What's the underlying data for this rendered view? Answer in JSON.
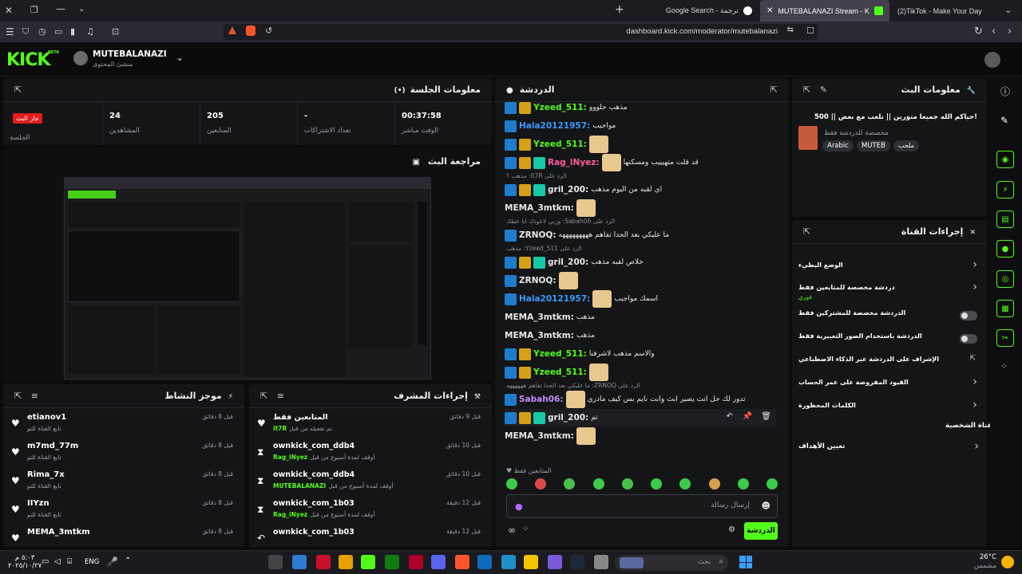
{
  "browser": {
    "tabs": [
      {
        "label": "Google Search - ترجمة"
      },
      {
        "label": "MUTEBALANAZI Stream - Kick D"
      },
      {
        "label": "(2)TikTok - Make Your Day"
      }
    ],
    "url": "dashboard.kick.com/moderator/mutebalanazi"
  },
  "header": {
    "logo": "KICK",
    "beta": "BETA",
    "channel_name": "MUTEBALANAZI",
    "channel_sub": "منشئ المحتوى"
  },
  "session": {
    "title": "معلومات الجلسة",
    "live_badge": "جار البث",
    "session_label": "الجلسة",
    "stats": [
      {
        "value": "24",
        "label": "المشاهدين"
      },
      {
        "value": "205",
        "label": "المتابعين"
      },
      {
        "value": "-",
        "label": "تعداد الاشتراكات"
      },
      {
        "value": "00:37:58",
        "label": "الوقت مباشر"
      }
    ]
  },
  "preview": {
    "title": "مراجعة البث"
  },
  "activity": {
    "title": "موجز النشاط",
    "items": [
      {
        "name": "etianov1",
        "sub": "تابع القناة للتو",
        "time": "قبل 8 دقائق"
      },
      {
        "name": "m7md_77m",
        "sub": "تابع القناة للتو",
        "time": "قبل 8 دقائق"
      },
      {
        "name": "Rima_7x",
        "sub": "تابع القناة للتو",
        "time": "قبل 8 دقائق"
      },
      {
        "name": "IIYzn",
        "sub": "تابع القناة للتو",
        "time": "قبل 8 دقائق"
      },
      {
        "name": "MEMA_3mtkm",
        "sub": "",
        "time": "قبل 8 دقائق"
      }
    ]
  },
  "mod": {
    "title": "إجراءات المشرف",
    "items": [
      {
        "name": "المتابعين فقط",
        "sub": "تم تفعيله من قبل",
        "actor": "it7R",
        "time": "قبل 9 دقائق"
      },
      {
        "name": "ownkick_com_ddb4",
        "sub": "أوقف لمدة أسبوع من قبل",
        "actor": "Rag_iNyez",
        "time": "قبل 10 دقائق"
      },
      {
        "name": "ownkick_com_ddb4",
        "sub": "أوقف لمدة أسبوع من قبل",
        "actor": "MUTEBALANAZI",
        "time": "قبل 10 دقائق"
      },
      {
        "name": "ownkick_com_1b03",
        "sub": "أوقف لمدة أسبوع من قبل",
        "actor": "Rag_iNyez",
        "time": "قبل 12 دقيقة"
      },
      {
        "name": "ownkick_com_1b03",
        "sub": "",
        "actor": "",
        "time": "قبل 12 دقيقة"
      }
    ]
  },
  "chat": {
    "title": "الدردشة",
    "messages": [
      {
        "user": "Yzeed_511:",
        "text": "مذهب حلووو",
        "color": "#53fc18"
      },
      {
        "user": "Hala20121957:",
        "text": "مواجيب",
        "color": "#3b9cff"
      },
      {
        "user": "Yzeed_511:",
        "text": "",
        "color": "#53fc18"
      },
      {
        "user": "Rag_iNyez:",
        "text": "قد قلت متهيييب ومسكنها",
        "color": "#ff5fa2"
      },
      {
        "user": "gril_200:",
        "text": "اي لقبه من اليوم مذهب",
        "color": "#e8e8e8",
        "reply": "الرد على it7R: مذهب ؟"
      },
      {
        "user": "MEMA_3mtkm:",
        "text": "",
        "color": "#e8e8e8"
      },
      {
        "user": "ZRNOQ:",
        "text": "ما عليكي بعد الحدا تفاهم هههههههههه",
        "color": "#e8e8e8",
        "reply": "الرد على Sabah06: وربي لاعوذك انا عطك"
      },
      {
        "user": "gril_200:",
        "text": "خلاص لقبه مذهب",
        "color": "#e8e8e8",
        "reply": "الرد على Yzeed_511: مذهب"
      },
      {
        "user": "ZRNOQ:",
        "text": "",
        "color": "#e8e8e8"
      },
      {
        "user": "Hala20121957:",
        "text": "اسمك مواجيب",
        "color": "#3b9cff"
      },
      {
        "user": "MEMA_3mtkm:",
        "text": "مذهب",
        "color": "#e8e8e8"
      },
      {
        "user": "MEMA_3mtkm:",
        "text": "مذهب",
        "color": "#e8e8e8"
      },
      {
        "user": "Yzeed_511:",
        "text": "والاسم مذهب لاشرفنا",
        "color": "#53fc18"
      },
      {
        "user": "Yzeed_511:",
        "text": "",
        "color": "#53fc18"
      },
      {
        "user": "Sabah06:",
        "text": "تدور لك حل انت يصير ابث وانت نايم بس كيف مادري",
        "color": "#c58af9",
        "reply": "الرد على ZRNOQ: ما عليكي بعد الحدا تفاهم ههههههه"
      },
      {
        "user": "gril_200:",
        "text": "تم",
        "color": "#e8e8e8"
      },
      {
        "user": "MEMA_3mtkm:",
        "text": "",
        "color": "#e8e8e8"
      }
    ],
    "followers_only": "المتابعين فقط",
    "input_placeholder": "إرسال رسالة",
    "send_label": "الدردشة"
  },
  "stream_info": {
    "title": "معلومات البث",
    "stream_title": "حياكم الله جميعا متورين || نلعب مع بعض || 500!",
    "category": "مخصصة للدردشة فقط",
    "tags": [
      "Arabic",
      "MUTEB",
      "ملحب"
    ]
  },
  "channel_actions": {
    "title": "إجراءات القناة",
    "items": [
      {
        "label": "الوضع البطيء",
        "control": "chevron"
      },
      {
        "label": "دردشة مخصصة للمتابعين فقط",
        "sub": "فوري",
        "control": "chevron"
      },
      {
        "label": "الدردشة مخصصة للمشتركين فقط",
        "control": "toggle"
      },
      {
        "label": "الدردشة باستخدام الصور التعبيرية فقط",
        "control": "toggle"
      },
      {
        "label": "الإشراف على الدردشة عبر الذكاء الاصطناعي",
        "control": "external"
      },
      {
        "label": "القيود المفروضة على عمر الحساب",
        "control": "chevron"
      },
      {
        "label": "الكلمات المحظورة",
        "control": "chevron"
      }
    ],
    "personal_section": "القناة الشخصية",
    "goals_label": "تعيين الأهداف"
  },
  "taskbar": {
    "time": "٥:٠٣ م",
    "date": "٢٠٢٥/١٠/٢٧",
    "lang": "ENG",
    "search_placeholder": "بحث",
    "temp": "26°C",
    "weather": "مشمس"
  }
}
